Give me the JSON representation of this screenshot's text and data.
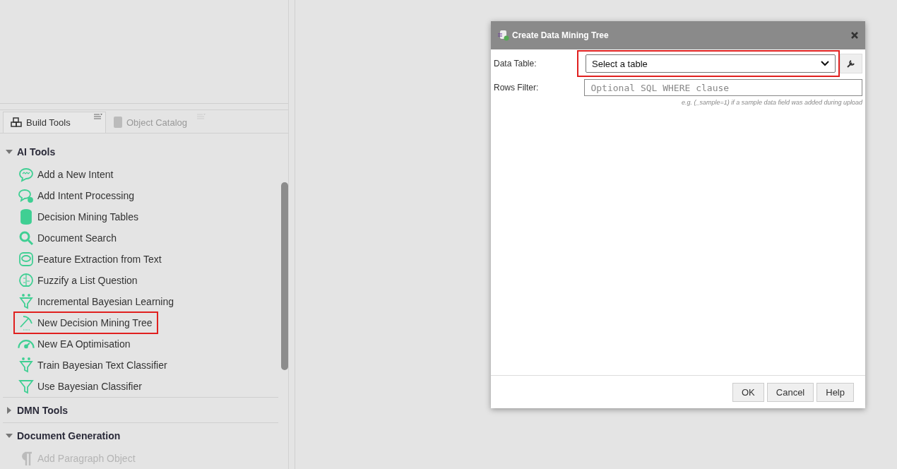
{
  "panel_tabs": [
    {
      "label": "Build Tools",
      "selected": true
    },
    {
      "label": "Object Catalog",
      "selected": false
    }
  ],
  "groups": [
    {
      "label": "AI Tools",
      "expanded": true,
      "items": [
        {
          "label": "Add a New Intent",
          "kind": "chat",
          "highlighted": false,
          "disabled": false
        },
        {
          "label": "Add Intent Processing",
          "kind": "chat-gear",
          "highlighted": false,
          "disabled": false
        },
        {
          "label": "Decision Mining Tables",
          "kind": "database",
          "highlighted": false,
          "disabled": false
        },
        {
          "label": "Document Search",
          "kind": "search",
          "highlighted": false,
          "disabled": false
        },
        {
          "label": "Feature Extraction from Text",
          "kind": "chip",
          "highlighted": false,
          "disabled": false
        },
        {
          "label": "Fuzzify a List Question",
          "kind": "brain",
          "highlighted": false,
          "disabled": false
        },
        {
          "label": "Incremental Bayesian Learning",
          "kind": "funnel-dots",
          "highlighted": false,
          "disabled": false
        },
        {
          "label": "New Decision Mining Tree",
          "kind": "pickaxe",
          "highlighted": true,
          "disabled": false
        },
        {
          "label": "New EA Optimisation",
          "kind": "gauge",
          "highlighted": false,
          "disabled": false
        },
        {
          "label": "Train Bayesian Text Classifier",
          "kind": "funnel-dots",
          "highlighted": false,
          "disabled": false
        },
        {
          "label": "Use Bayesian Classifier",
          "kind": "funnel",
          "highlighted": false,
          "disabled": false
        }
      ]
    },
    {
      "label": "DMN Tools",
      "expanded": false
    },
    {
      "label": "Document Generation",
      "expanded": true,
      "items": [
        {
          "label": "Add Paragraph Object",
          "kind": "pilcrow",
          "highlighted": false,
          "disabled": true
        }
      ]
    }
  ],
  "dialog": {
    "title": "Create Data Mining Tree",
    "data_table": {
      "label": "Data Table:",
      "value": "Select a table",
      "highlighted": true
    },
    "rows_filter": {
      "label": "Rows Filter:",
      "placeholder": "Optional SQL WHERE clause",
      "hint": "e.g. (_sample=1) if a sample data field was added during upload"
    },
    "buttons": [
      "OK",
      "Cancel",
      "Help"
    ]
  }
}
